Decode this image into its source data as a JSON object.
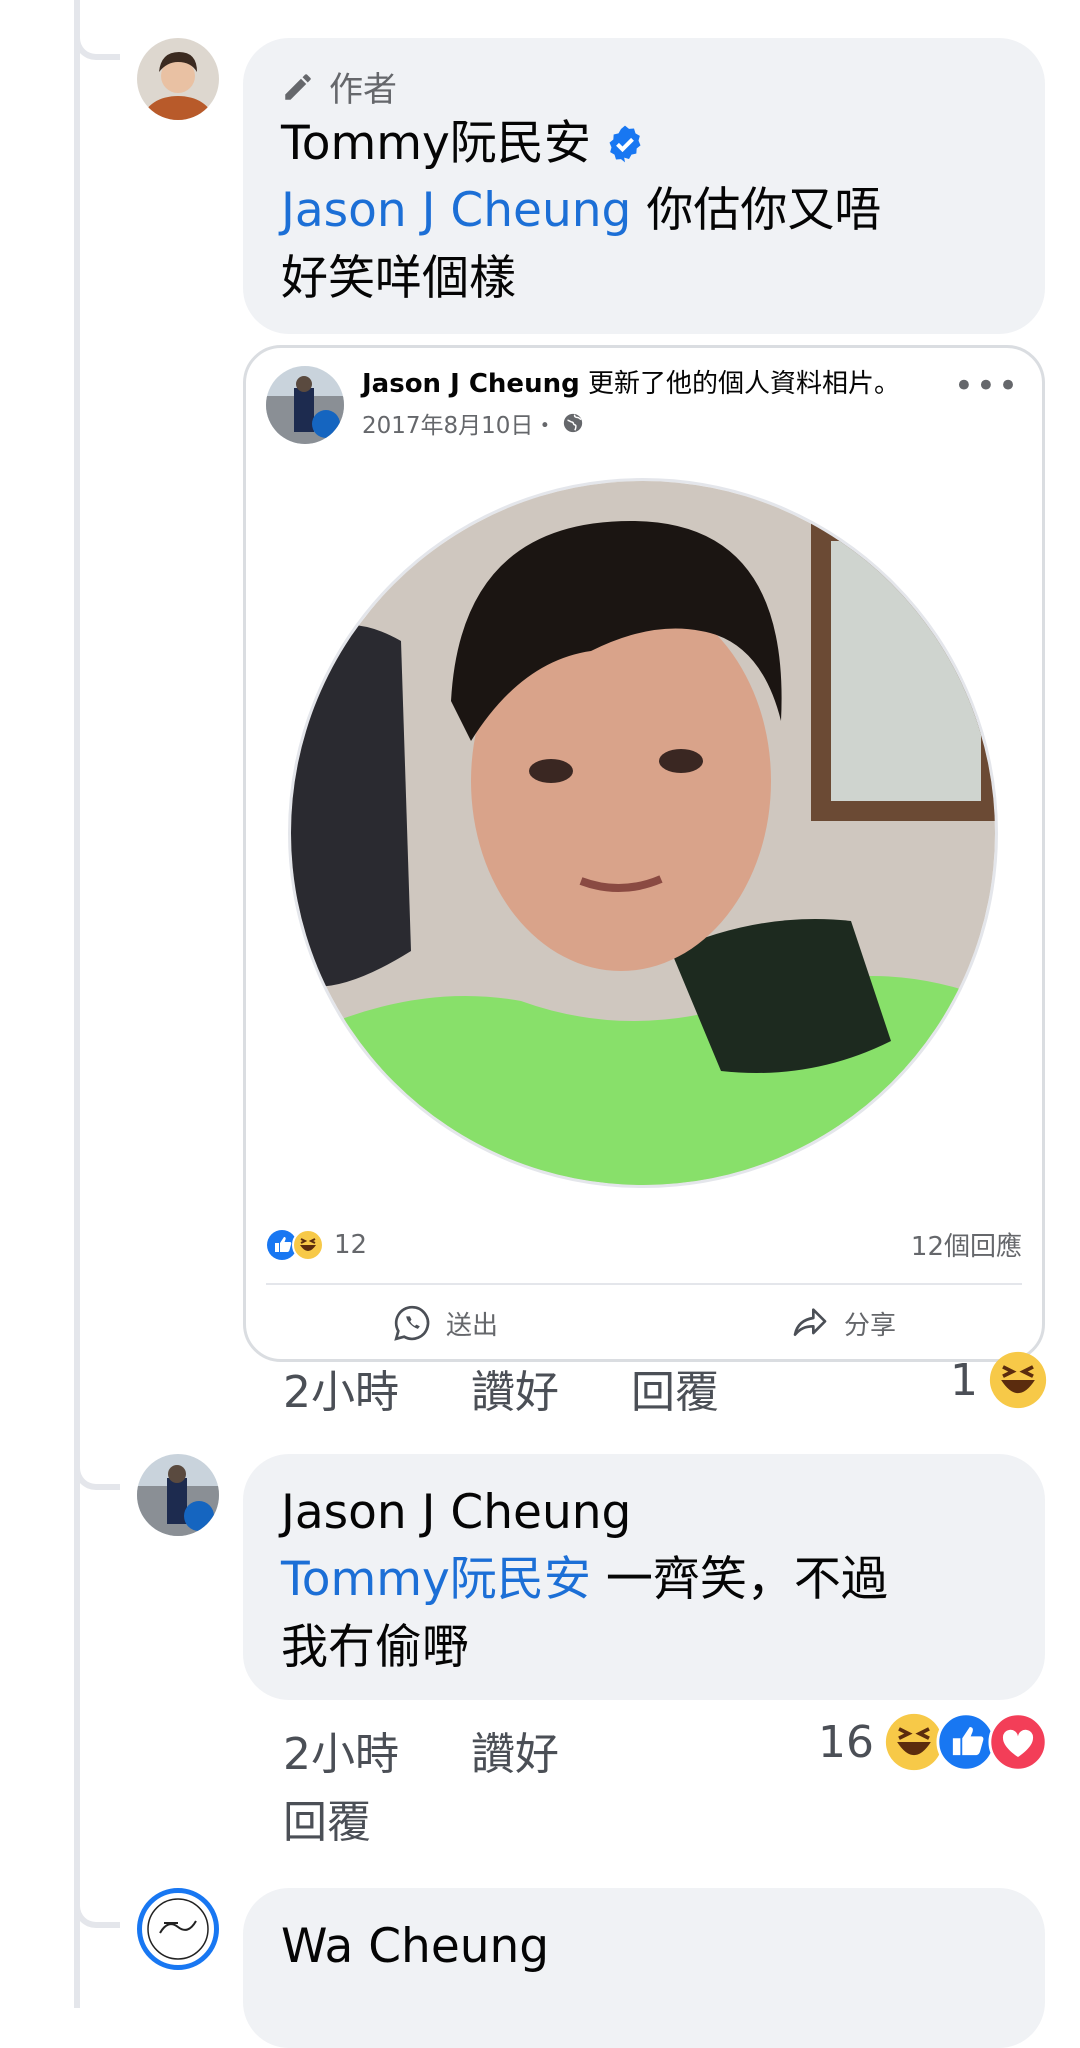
{
  "comment1": {
    "badge_label": "作者",
    "author": "Tommy阮民安",
    "mention": "Jason J Cheung",
    "text_line1": " 你估你又唔",
    "text_line2": "好笑咩個樣",
    "time": "2小時",
    "like_label": "讚好",
    "reply_label": "回覆",
    "reaction_count": "1"
  },
  "shared_post": {
    "author": "Jason J Cheung",
    "action": " 更新了他的個人資料相片。",
    "date": "2017年8月10日・",
    "reaction_count": "12",
    "comments_count": "12個回應",
    "send_label": "送出",
    "share_label": "分享"
  },
  "comment2": {
    "author": "Jason J Cheung",
    "mention": "Tommy阮民安",
    "text_line1": " 一齊笑，不過",
    "text_line2": "我冇偷嘢",
    "time": "2小時",
    "like_label": "讚好",
    "reply_label": "回覆",
    "reaction_count": "16"
  },
  "comment3": {
    "author": "Wa Cheung"
  },
  "colors": {
    "mention_blue": "#1c6fd6",
    "bubble_bg": "#f0f2f5",
    "verified_blue": "#1877f2"
  }
}
